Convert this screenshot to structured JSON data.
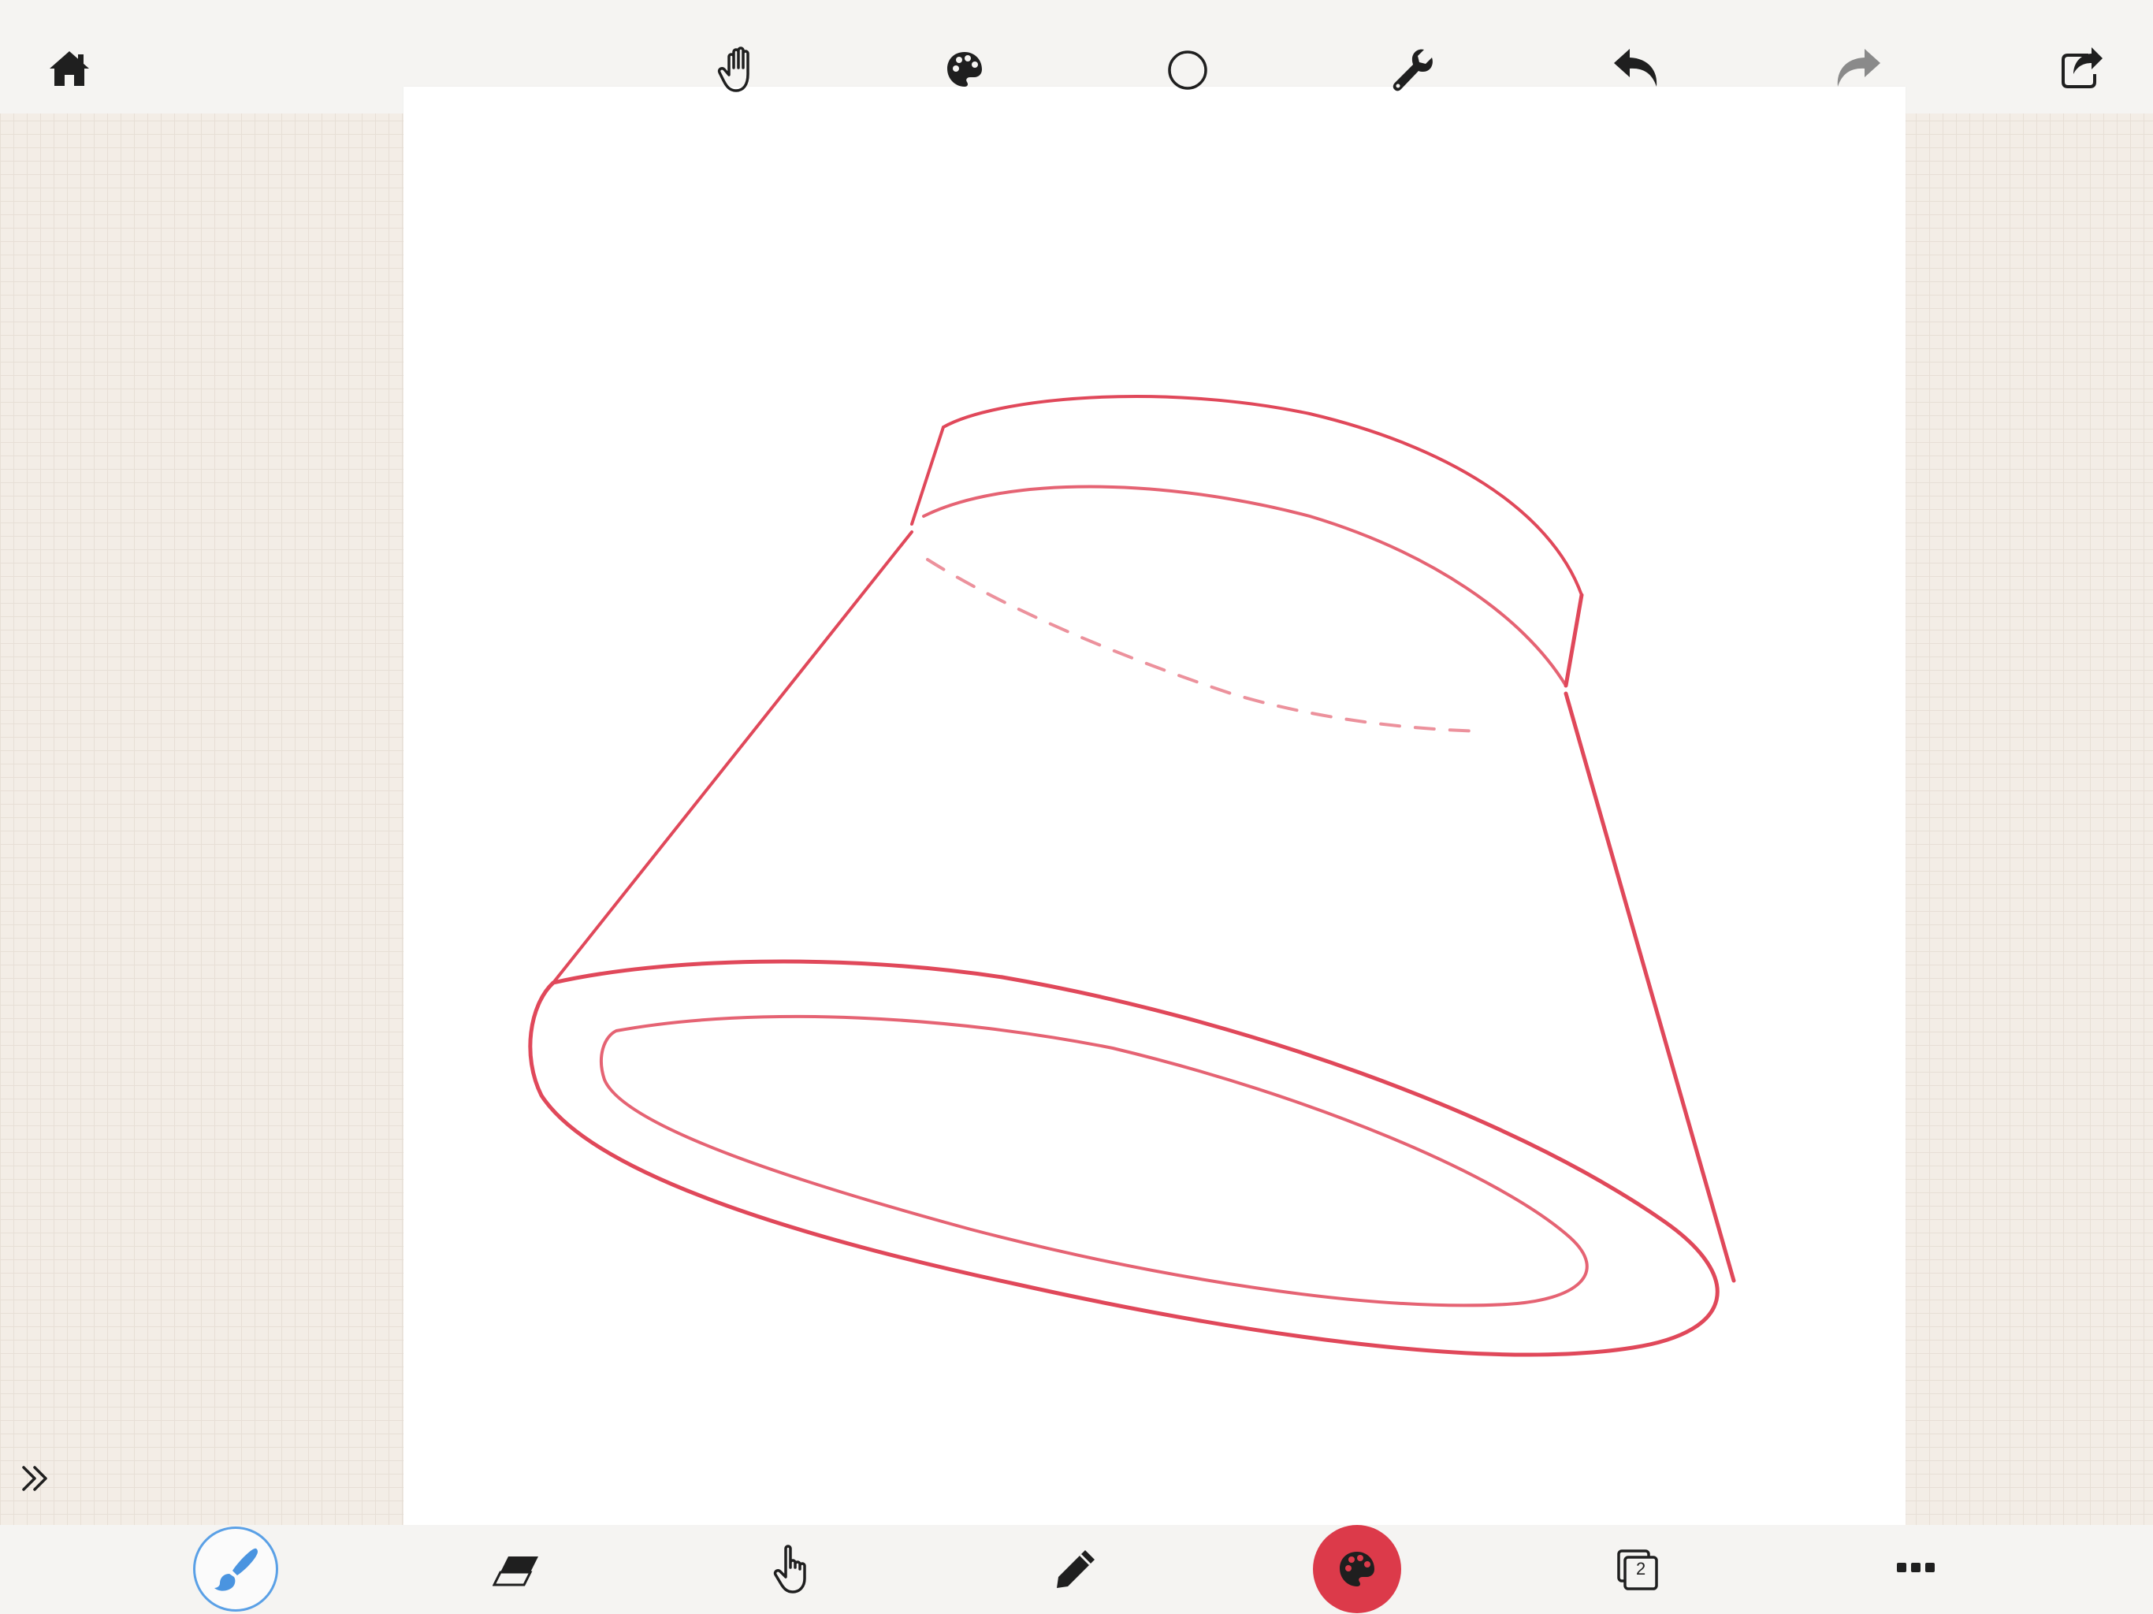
{
  "app": {
    "accent_color": "#dc3a4a",
    "brush_highlight_color": "#5aa0e6",
    "stroke_color": "#e0485a"
  },
  "top_toolbar": {
    "items": [
      {
        "name": "home",
        "icon": "house-icon"
      },
      {
        "name": "pan",
        "icon": "hand-icon"
      },
      {
        "name": "palette",
        "icon": "palette-icon"
      },
      {
        "name": "shape",
        "icon": "circle-icon"
      },
      {
        "name": "settings",
        "icon": "wrench-icon"
      },
      {
        "name": "undo",
        "icon": "undo-arrow-icon"
      },
      {
        "name": "redo",
        "icon": "redo-arrow-icon",
        "enabled": false
      },
      {
        "name": "share",
        "icon": "share-icon"
      }
    ]
  },
  "bottom_toolbar": {
    "items": [
      {
        "name": "brush",
        "icon": "paintbrush-icon",
        "selected": true
      },
      {
        "name": "eraser",
        "icon": "eraser-icon"
      },
      {
        "name": "touch",
        "icon": "pointer-hand-icon"
      },
      {
        "name": "pencil",
        "icon": "pencil-icon"
      },
      {
        "name": "color",
        "icon": "palette-icon",
        "color": "#dc3a4a"
      },
      {
        "name": "layers",
        "icon": "layers-icon",
        "count": "2"
      },
      {
        "name": "more",
        "icon": "ellipsis-icon"
      }
    ]
  },
  "sidebar": {
    "expand_icon": "double-chevron-right-icon"
  }
}
